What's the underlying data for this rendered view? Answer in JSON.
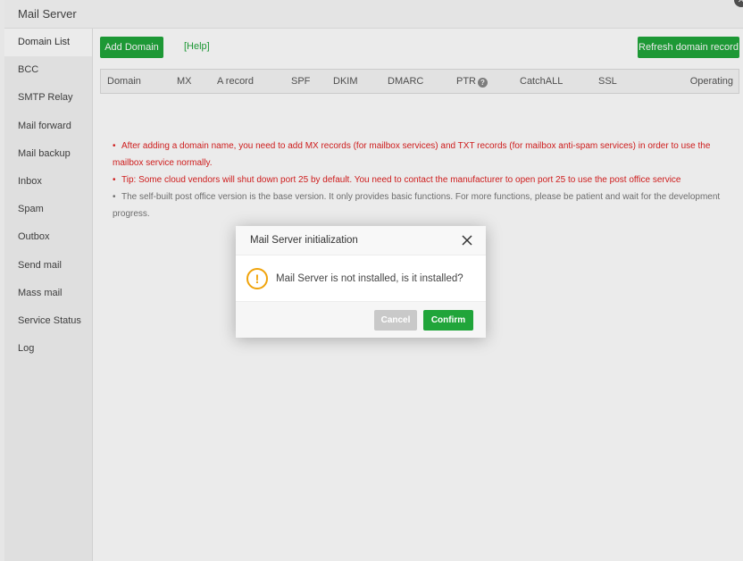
{
  "window": {
    "title": "Mail Server"
  },
  "sidebar": {
    "items": [
      {
        "label": "Domain List",
        "active": true
      },
      {
        "label": "BCC"
      },
      {
        "label": "SMTP Relay"
      },
      {
        "label": "Mail forward"
      },
      {
        "label": "Mail backup"
      },
      {
        "label": "Inbox"
      },
      {
        "label": "Spam"
      },
      {
        "label": "Outbox"
      },
      {
        "label": "Send mail"
      },
      {
        "label": "Mass mail"
      },
      {
        "label": "Service Status"
      },
      {
        "label": "Log"
      }
    ]
  },
  "toolbar": {
    "add_domain": "Add Domain",
    "help": "[Help]",
    "refresh": "Refresh domain record"
  },
  "table": {
    "columns": [
      "Domain",
      "MX",
      "A record",
      "SPF",
      "DKIM",
      "DMARC",
      "PTR",
      "CatchALL",
      "SSL",
      "Operating"
    ]
  },
  "tips": [
    {
      "text": "After adding a domain name, you need to add MX records (for mailbox services) and TXT records (for mailbox anti-spam services) in order to use the mailbox service normally.",
      "color": "#e02020"
    },
    {
      "text": "Tip: Some cloud vendors will shut down port 25 by default. You need to contact the manufacturer to open port 25 to use the post office service",
      "color": "#e02020"
    },
    {
      "text": "The self-built post office version is the base version. It only provides basic functions. For more functions, please be patient and wait for the development progress.",
      "color": "#777777"
    }
  ],
  "dialog": {
    "title": "Mail Server initialization",
    "message": "Mail Server is not installed, is it installed?",
    "cancel": "Cancel",
    "confirm": "Confirm"
  },
  "colors": {
    "accent": "#20a53a",
    "warning": "#f0a30a",
    "danger": "#e02020"
  }
}
